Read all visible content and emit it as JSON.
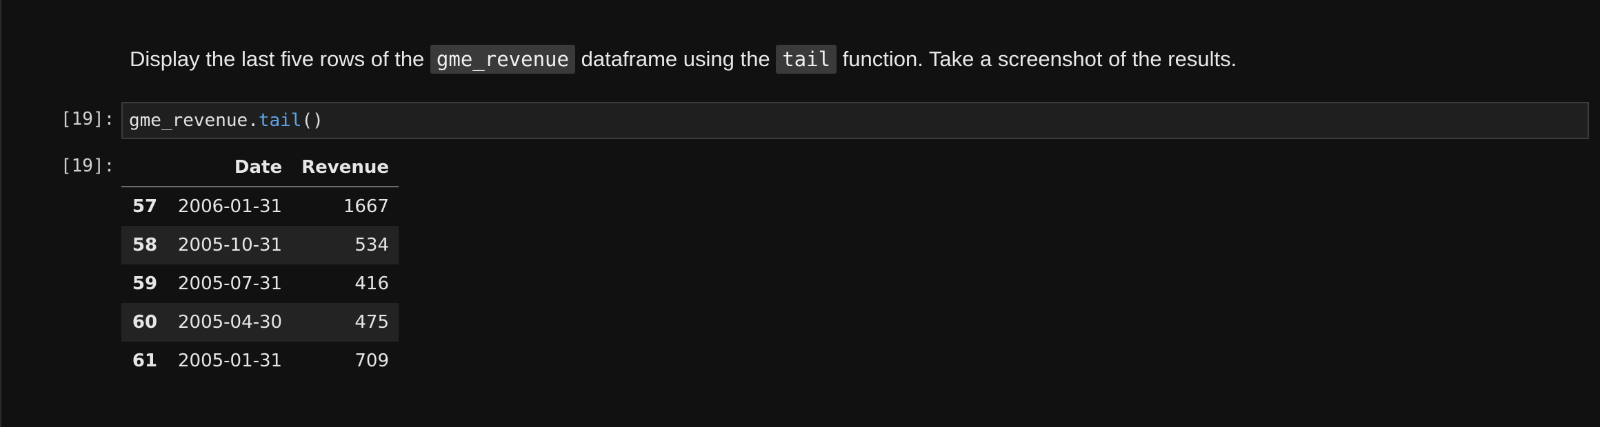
{
  "markdown": {
    "text_before": "Display the last five rows of the ",
    "code_1": "gme_revenue",
    "text_middle": " dataframe using the ",
    "code_2": "tail",
    "text_after": " function. Take a screenshot of the results."
  },
  "input_cell": {
    "prompt": "[19]:",
    "code_object": "gme_revenue",
    "code_dot": ".",
    "code_method": "tail",
    "code_parens": "()"
  },
  "output_cell": {
    "prompt": "[19]:",
    "columns": [
      "",
      "Date",
      "Revenue"
    ],
    "rows": [
      {
        "index": "57",
        "date": "2006-01-31",
        "revenue": "1667"
      },
      {
        "index": "58",
        "date": "2005-10-31",
        "revenue": "534"
      },
      {
        "index": "59",
        "date": "2005-07-31",
        "revenue": "416"
      },
      {
        "index": "60",
        "date": "2005-04-30",
        "revenue": "475"
      },
      {
        "index": "61",
        "date": "2005-01-31",
        "revenue": "709"
      }
    ]
  },
  "colors": {
    "background": "#111111",
    "code_method": "#5ea4e8",
    "inline_code_bg": "#3a3a3a",
    "striped_row": "#232323"
  }
}
